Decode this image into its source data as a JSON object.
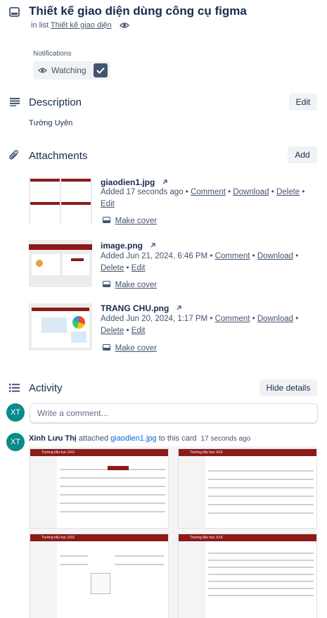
{
  "card": {
    "title": "Thiết kế giao diện dùng công cụ figma",
    "in_list_prefix": "in list",
    "list_name": "Thiết kế giao diện"
  },
  "notifications": {
    "heading": "Notifications",
    "watch_label": "Watching"
  },
  "description": {
    "heading": "Description",
    "edit_label": "Edit",
    "text": "Tường Uyên"
  },
  "attachments": {
    "heading": "Attachments",
    "add_label": "Add",
    "items": [
      {
        "name": "giaodien1.jpg",
        "added": "Added 17 seconds ago",
        "comment": "Comment",
        "download": "Download",
        "delete": "Delete",
        "edit": "Edit",
        "make_cover": "Make cover"
      },
      {
        "name": "image.png",
        "added": "Added Jun 21, 2024, 6:46 PM",
        "comment": "Comment",
        "download": "Download",
        "delete": "Delete",
        "edit": "Edit",
        "make_cover": "Make cover"
      },
      {
        "name": "TRANG CHU.png",
        "added": "Added Jun 20, 2024, 1:17 PM",
        "comment": "Comment",
        "download": "Download",
        "delete": "Delete",
        "edit": "Edit",
        "make_cover": "Make cover"
      }
    ]
  },
  "activity": {
    "heading": "Activity",
    "hide_details_label": "Hide details",
    "comment_placeholder": "Write a comment...",
    "user_initials": "XT",
    "entry": {
      "initials": "XT",
      "user": "Xinh Lưu Thị",
      "action": "attached",
      "file": "giaodien1.jpg",
      "suffix": "to this card",
      "time": "17 seconds ago"
    },
    "preview_header": "Trường tiểu học XXX"
  },
  "colors": {
    "accent": "#8b1a1a",
    "avatar": "#0b8a8a",
    "text": "#172b4d",
    "muted": "#44546f"
  },
  "icons": [
    "card-icon",
    "eye-icon",
    "check-icon",
    "description-icon",
    "paperclip-icon",
    "external-link-icon",
    "cover-icon",
    "activity-icon"
  ]
}
